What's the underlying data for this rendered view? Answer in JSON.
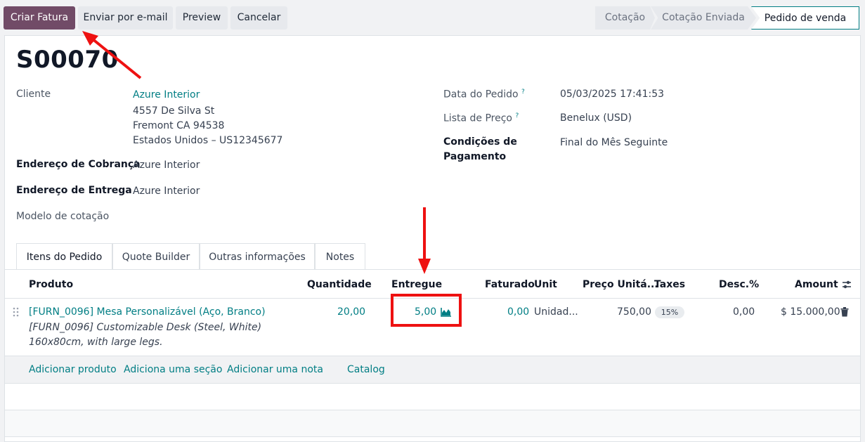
{
  "toolbar": {
    "create_invoice": "Criar Fatura",
    "send_email": "Enviar por e-mail",
    "preview": "Preview",
    "cancel": "Cancelar"
  },
  "statusbar": {
    "stages": [
      "Cotação",
      "Cotação Enviada",
      "Pedido de venda"
    ],
    "active": "Pedido de venda"
  },
  "order": {
    "name": "S00070",
    "customer_label": "Cliente",
    "customer": "Azure Interior",
    "address_line1": "4557 De Silva St",
    "address_line2": "Fremont CA 94538",
    "address_line3": "Estados Unidos – US12345677",
    "invoice_address_label": "Endereço de Cobrança",
    "invoice_address": "Azure Interior",
    "delivery_address_label": "Endereço de Entrega",
    "delivery_address": "Azure Interior",
    "template_label": "Modelo de cotação",
    "date_label": "Data do Pedido",
    "date": "05/03/2025 17:41:53",
    "pricelist_label": "Lista de Preço",
    "pricelist": "Benelux (USD)",
    "payment_terms_label_1": "Condições de",
    "payment_terms_label_2": "Pagamento",
    "payment_terms": "Final do Mês Seguinte",
    "help_mark": "?"
  },
  "tabs": [
    "Itens do Pedido",
    "Quote Builder",
    "Outras informações",
    "Notes"
  ],
  "table": {
    "headers": {
      "product": "Produto",
      "quantity": "Quantidade",
      "delivered": "Entregue",
      "invoiced": "Faturado",
      "unit": "Unit",
      "price": "Preço Unitá...",
      "taxes": "Taxes",
      "discount": "Desc.%",
      "amount": "Amount"
    },
    "line": {
      "product": "[FURN_0096] Mesa Personalizável (Aço, Branco)",
      "description_1": "[FURN_0096] Customizable Desk (Steel, White)",
      "description_2": "160x80cm, with large legs.",
      "quantity": "20,00",
      "delivered": "5,00",
      "invoiced": "0,00",
      "unit": "Unidad...",
      "price": "750,00",
      "tax": "15%",
      "discount": "0,00",
      "amount": "$ 15.000,00"
    },
    "add_links": {
      "product": "Adicionar produto",
      "section": "Adiciona uma seção",
      "note": "Adicionar uma nota",
      "catalog": "Catalog"
    }
  },
  "colors": {
    "primary": "#714b67",
    "link": "#017e84",
    "annotation": "#ee1111"
  }
}
